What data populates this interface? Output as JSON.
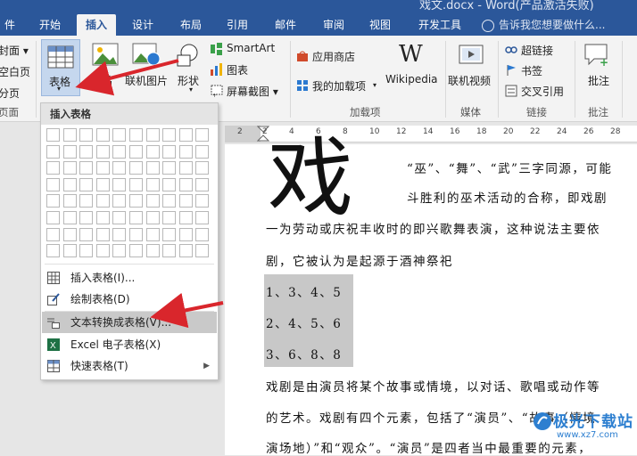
{
  "titlebar": {
    "doc_title": "戏文.docx - Word(产品激活失败)"
  },
  "tabs": [
    {
      "label": "件"
    },
    {
      "label": "开始"
    },
    {
      "label": "插入"
    },
    {
      "label": "设计"
    },
    {
      "label": "布局"
    },
    {
      "label": "引用"
    },
    {
      "label": "邮件"
    },
    {
      "label": "审阅"
    },
    {
      "label": "视图"
    },
    {
      "label": "开发工具"
    }
  ],
  "tell_me": "告诉我您想要做什么...",
  "ribbon": {
    "left_items": [
      "封面 ▾",
      "空白页",
      "分页",
      "页面"
    ],
    "table_button": "表格",
    "images": "图片",
    "online_images": "联机图片",
    "shapes": "形状",
    "smartart": "SmartArt",
    "chart": "图表",
    "screenshot": "屏幕截图 ▾",
    "app_store": "应用商店",
    "my_addins": "我的加载项",
    "wikipedia": "Wikipedia",
    "wiki_glyph": "W",
    "online_video": "联机视频",
    "hyperlink": "超链接",
    "bookmark": "书签",
    "cross_ref": "交叉引用",
    "comment": "批注",
    "groups": {
      "addins": "加载项",
      "media": "媒体",
      "links": "链接",
      "comments": "批注"
    }
  },
  "dropdown": {
    "header": "插入表格",
    "items": [
      {
        "label": "插入表格(I)..."
      },
      {
        "label": "绘制表格(D)"
      },
      {
        "label": "文本转换成表格(V)..."
      },
      {
        "label": "Excel 电子表格(X)"
      },
      {
        "label": "快速表格(T)"
      }
    ]
  },
  "ruler": {
    "numbers": [
      "2",
      "2",
      "4",
      "6",
      "8",
      "10",
      "12",
      "14",
      "16",
      "18",
      "20",
      "22",
      "24",
      "26",
      "28"
    ]
  },
  "document": {
    "big_char": "戏",
    "lines": [
      "“巫”、“舞”、“武”三字同源，可能",
      "斗胜利的巫术活动的合称，即戏剧",
      "一为劳动或庆祝丰收时的即兴歌舞表演，这种说法主要依",
      "剧，它被认为是起源于酒神祭祀",
      "1、3、4、5",
      "2、4、5、6",
      "3、6、8、8",
      "戏剧是由演员将某个故事或情境，以对话、歌唱或动作等",
      "的艺术。戏剧有四个元素，包括了“演员”、“故事（情境",
      "演场地）”和“观众”。“演员”是四者当中最重要的元素，"
    ]
  },
  "watermark": {
    "title": "极光下载站",
    "url": "www.xz7.com"
  },
  "colors": {
    "ribbon_blue": "#2b579a",
    "arrow_red": "#d9262c"
  }
}
